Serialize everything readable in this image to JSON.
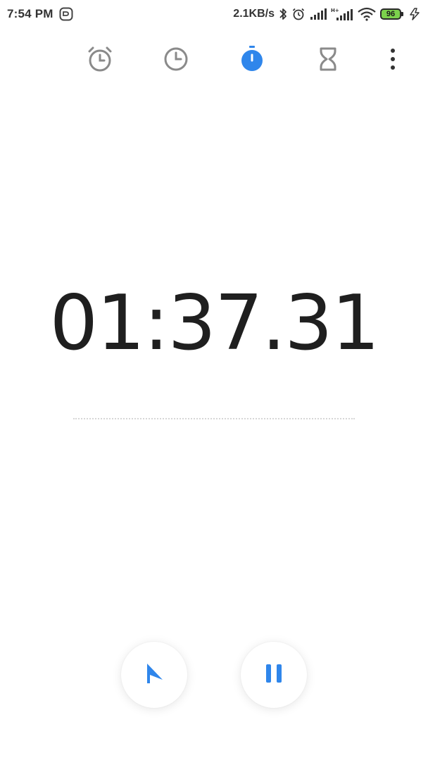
{
  "status_bar": {
    "time": "7:54 PM",
    "network_speed": "2.1KB/s",
    "battery_level": "96",
    "icons": [
      "notification-app-icon",
      "bluetooth-icon",
      "alarm-icon",
      "signal-icon",
      "signal-h-plus-icon",
      "wifi-icon",
      "battery-icon",
      "charging-icon"
    ]
  },
  "tabs": [
    {
      "icon": "alarm-clock-icon",
      "active": false
    },
    {
      "icon": "world-clock-icon",
      "active": false
    },
    {
      "icon": "stopwatch-icon",
      "active": true
    },
    {
      "icon": "hourglass-icon",
      "active": false
    }
  ],
  "menu": {
    "icon": "more-vertical-icon"
  },
  "stopwatch": {
    "elapsed": "01:37.31"
  },
  "controls": {
    "lap_icon": "flag-icon",
    "pause_icon": "pause-icon"
  },
  "colors": {
    "accent": "#2f86eb",
    "icon_gray": "#8a8a8a",
    "text": "#1f1f1f",
    "battery_fill": "#7cd14c"
  }
}
